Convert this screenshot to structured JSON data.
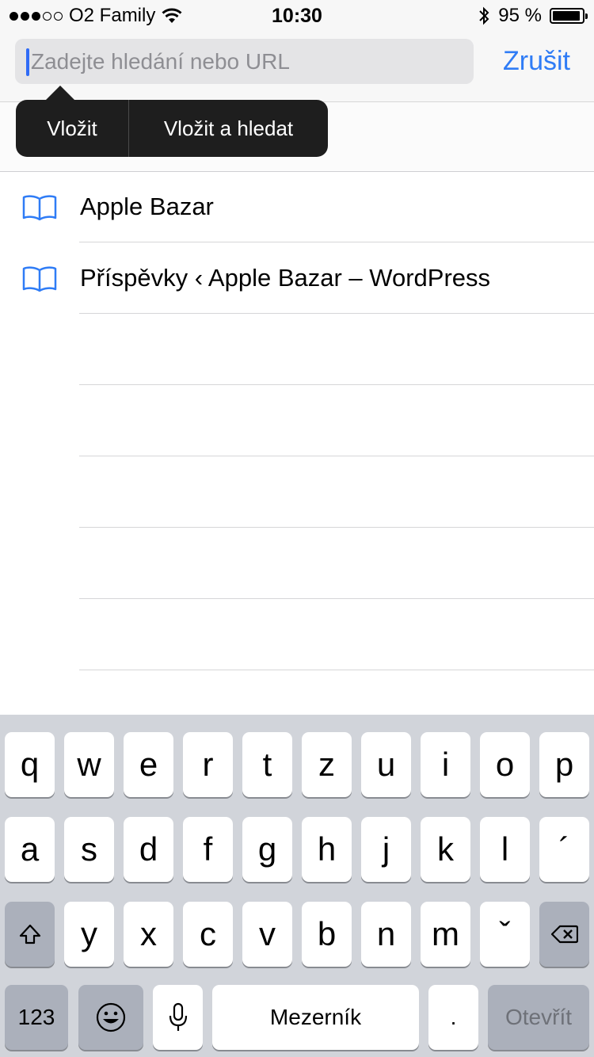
{
  "status_bar": {
    "carrier": "O2 Family",
    "time": "10:30",
    "battery": "95 %",
    "battery_level": 0.95,
    "signal_bars_filled": 3,
    "signal_bars_total": 5
  },
  "header": {
    "search_placeholder": "Zadejte hledání nebo URL",
    "search_value": "",
    "cancel_label": "Zrušit"
  },
  "edit_menu": {
    "items": [
      "Vložit",
      "Vložit a hledat"
    ]
  },
  "bookmarks": [
    {
      "title": "Apple Bazar",
      "icon": "book-icon"
    },
    {
      "title": "Příspěvky ‹ Apple Bazar – WordPress",
      "icon": "book-icon"
    }
  ],
  "keyboard": {
    "row1": [
      "q",
      "w",
      "e",
      "r",
      "t",
      "z",
      "u",
      "i",
      "o",
      "p"
    ],
    "row2": [
      "a",
      "s",
      "d",
      "f",
      "g",
      "h",
      "j",
      "k",
      "l",
      "´"
    ],
    "row3": [
      "y",
      "x",
      "c",
      "v",
      "b",
      "n",
      "m",
      "ˇ"
    ],
    "numbers_label": "123",
    "space_label": "Mezerník",
    "period_label": ".",
    "go_label": "Otevřít",
    "shift_icon": "shift-icon",
    "delete_icon": "delete-icon",
    "emoji_icon": "emoji-icon",
    "mic_icon": "microphone-icon"
  },
  "colors": {
    "accent": "#2f7cf6",
    "cursor": "#2f6bf6",
    "keyboard_bg": "#d1d4da",
    "popup_bg": "#1e1e1e"
  }
}
